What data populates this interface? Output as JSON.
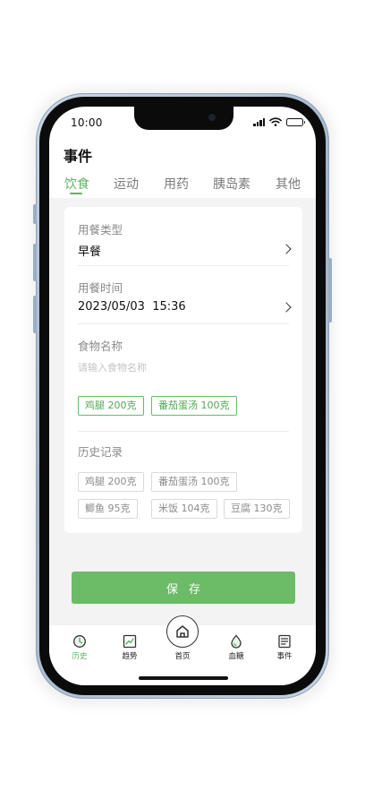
{
  "status_bar": {
    "time": "10:00"
  },
  "header": {
    "title": "事件"
  },
  "tabs": [
    {
      "label": "饮食",
      "active": true
    },
    {
      "label": "运动",
      "active": false
    },
    {
      "label": "用药",
      "active": false
    },
    {
      "label": "胰岛素",
      "active": false
    },
    {
      "label": "其他",
      "active": false
    }
  ],
  "form": {
    "meal_type": {
      "label": "用餐类型",
      "value": "早餐"
    },
    "meal_time": {
      "label": "用餐时间",
      "value": "2023/05/03  15:36"
    },
    "food_name": {
      "label": "食物名称",
      "placeholder": "请输入食物名称"
    },
    "selected_foods": [
      "鸡腿 200克",
      "番茄蛋汤 100克"
    ],
    "history": {
      "label": "历史记录",
      "items": [
        "鸡腿 200克",
        "番茄蛋汤 100克",
        "鲫鱼 95克",
        "米饭 104克",
        "豆腐 130克"
      ]
    }
  },
  "save_label": "保存",
  "bottom_nav": {
    "history": "历史",
    "trend": "趋势",
    "home": "首页",
    "glucose": "血糖",
    "events": "事件"
  },
  "colors": {
    "accent": "#5db45f",
    "button": "#6cbb66"
  }
}
